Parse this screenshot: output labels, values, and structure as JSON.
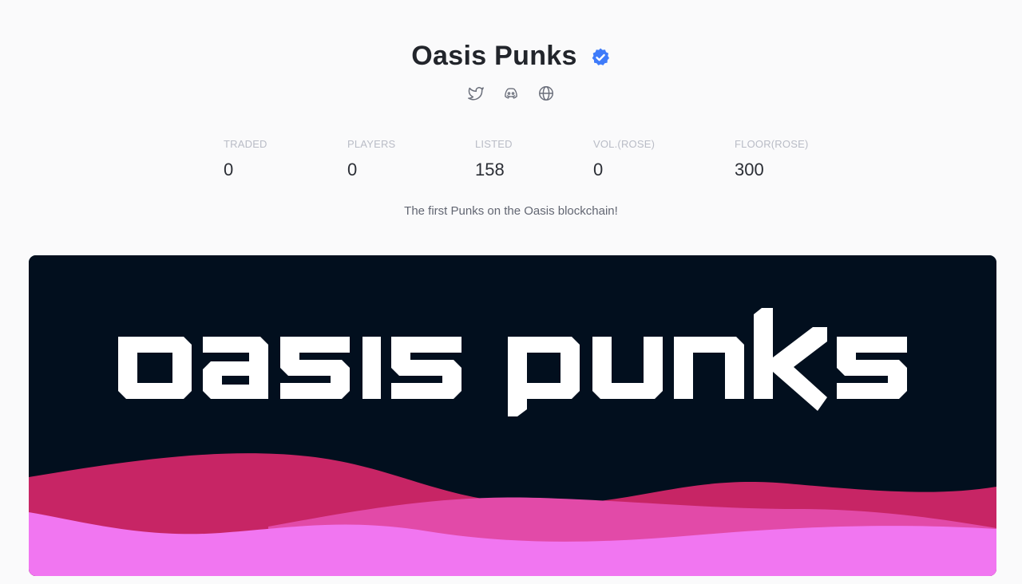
{
  "collection": {
    "name": "Oasis Punks",
    "verified_icon": "verified-badge-icon",
    "description": "The first Punks on the Oasis blockchain!"
  },
  "socials": [
    {
      "icon": "twitter-icon"
    },
    {
      "icon": "discord-icon"
    },
    {
      "icon": "globe-icon"
    }
  ],
  "stats": [
    {
      "label": "TRADED",
      "value": "0"
    },
    {
      "label": "PLAYERS",
      "value": "0"
    },
    {
      "label": "LISTED",
      "value": "158"
    },
    {
      "label": "VOL.(ROSE)",
      "value": "0"
    },
    {
      "label": "FLOOR(ROSE)",
      "value": "300"
    }
  ],
  "banner": {
    "logo_text": "oasis punks",
    "colors": {
      "background": "#020f1e",
      "wave_red": "#c72565",
      "wave_pink": "#e24aa8",
      "wave_violet": "#f176f1",
      "logo": "#ffffff"
    }
  },
  "colors": {
    "accent_verified": "#3e7bfa",
    "page_background": "#fafafb"
  }
}
